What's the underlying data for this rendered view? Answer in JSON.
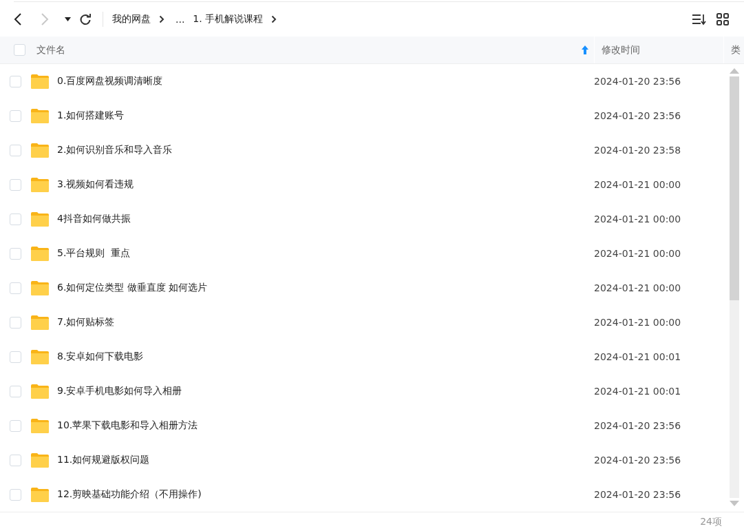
{
  "toolbar": {
    "nav": [
      {
        "kind": "back",
        "disabled": false
      },
      {
        "kind": "forward",
        "disabled": true
      }
    ],
    "breadcrumb": [
      {
        "label": "我的网盘",
        "separator": true
      },
      {
        "label": "...",
        "separator": false
      },
      {
        "label": "1. 手机解说课程",
        "separator": true
      }
    ]
  },
  "table": {
    "select_all": {
      "checked": false
    },
    "columns": [
      {
        "label": "文件名",
        "sorted_ascending": true
      },
      {
        "label": "修改时间"
      },
      {
        "label": "类"
      }
    ],
    "rows": [
      {
        "name": "0.百度网盘视频调清晰度",
        "modified": "2024-01-20 23:56",
        "checked": false
      },
      {
        "name": "1.如何搭建账号",
        "modified": "2024-01-20 23:56",
        "checked": false
      },
      {
        "name": "2.如何识别音乐和导入音乐",
        "modified": "2024-01-20 23:58",
        "checked": false
      },
      {
        "name": "3.视频如何看违规",
        "modified": "2024-01-21 00:00",
        "checked": false
      },
      {
        "name": "4抖音如何做共振",
        "modified": "2024-01-21 00:00",
        "checked": false
      },
      {
        "name": "5.平台规则  重点",
        "modified": "2024-01-21 00:00",
        "checked": false
      },
      {
        "name": "6.如何定位类型 做垂直度 如何选片",
        "modified": "2024-01-21 00:00",
        "checked": false
      },
      {
        "name": "7.如何贴标签",
        "modified": "2024-01-21 00:00",
        "checked": false
      },
      {
        "name": "8.安卓如何下载电影",
        "modified": "2024-01-21 00:01",
        "checked": false
      },
      {
        "name": "9.安卓手机电影如何导入相册",
        "modified": "2024-01-21 00:01",
        "checked": false
      },
      {
        "name": "10.苹果下载电影和导入相册方法",
        "modified": "2024-01-20 23:56",
        "checked": false
      },
      {
        "name": "11.如何规避版权问题",
        "modified": "2024-01-20 23:56",
        "checked": false
      },
      {
        "name": "12.剪映基础功能介绍（不用操作)",
        "modified": "2024-01-20 23:56",
        "checked": false
      }
    ]
  },
  "status_bar": {
    "count": "24项"
  }
}
